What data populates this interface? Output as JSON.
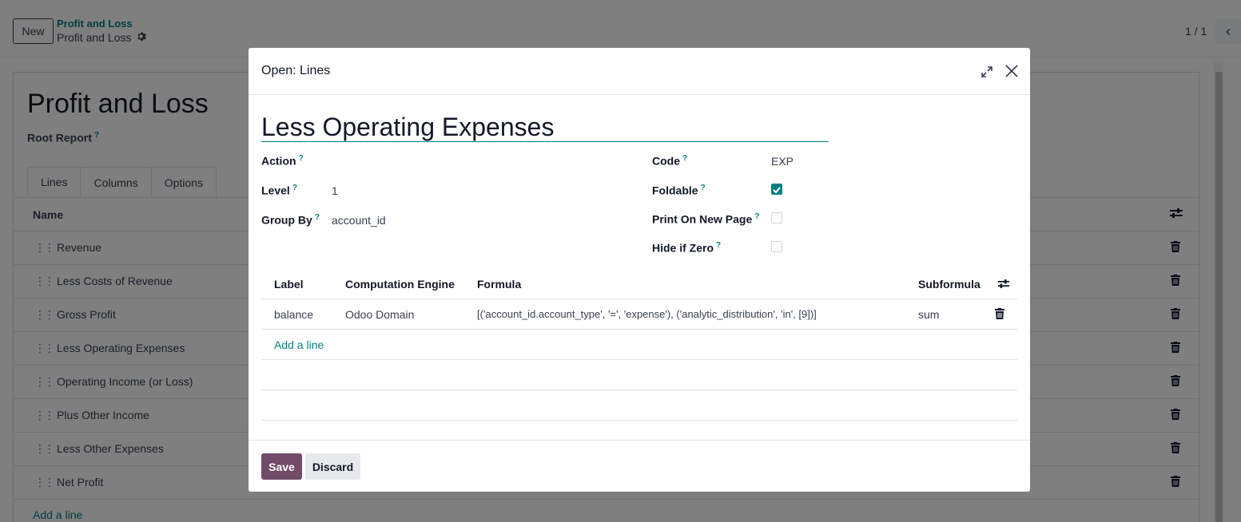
{
  "control_panel": {
    "new_label": "New",
    "breadcrumb_parent": "Profit and Loss",
    "breadcrumb_current": "Profit and Loss",
    "pager": "1 / 1"
  },
  "report": {
    "title": "Profit and Loss",
    "root_report_label": "Root Report",
    "help_mark": "?",
    "tabs": [
      {
        "label": "Lines",
        "active": true
      },
      {
        "label": "Columns",
        "active": false
      },
      {
        "label": "Options",
        "active": false
      }
    ],
    "list_header_name": "Name",
    "lines": [
      "Revenue",
      "Less Costs of Revenue",
      "Gross Profit",
      "Less Operating Expenses",
      "Operating Income (or Loss)",
      "Plus Other Income",
      "Less Other Expenses",
      "Net Profit"
    ],
    "add_line": "Add a line"
  },
  "modal": {
    "title": "Open: Lines",
    "record_name": "Less Operating Expenses",
    "fields": {
      "action_label": "Action",
      "action_value": "",
      "level_label": "Level",
      "level_value": "1",
      "group_by_label": "Group By",
      "group_by_value": "account_id",
      "code_label": "Code",
      "code_value": "EXP",
      "foldable_label": "Foldable",
      "foldable_checked": true,
      "print_new_page_label": "Print On New Page",
      "print_new_page_checked": false,
      "hide_if_zero_label": "Hide if Zero",
      "hide_if_zero_checked": false
    },
    "expressions": {
      "headers": {
        "label": "Label",
        "engine": "Computation Engine",
        "formula": "Formula",
        "subformula": "Subformula"
      },
      "rows": [
        {
          "label": "balance",
          "engine": "Odoo Domain",
          "formula": "[('account_id.account_type', '=', 'expense'), ('analytic_distribution', 'in', [9])]",
          "subformula": "sum"
        }
      ],
      "add_line": "Add a line"
    },
    "save_label": "Save",
    "discard_label": "Discard"
  },
  "colors": {
    "accent": "#017e84",
    "primary_button": "#714b67",
    "backdrop": "rgba(0,0,0,0.5)"
  },
  "icons": {
    "settings": "gear-icon",
    "expand": "expand-icon",
    "close": "close-icon",
    "delete": "trash-icon",
    "optional_columns": "sliders-icon",
    "drag": "drag-handle-icon",
    "checked": "check-icon",
    "previous": "chevron-left-icon"
  }
}
